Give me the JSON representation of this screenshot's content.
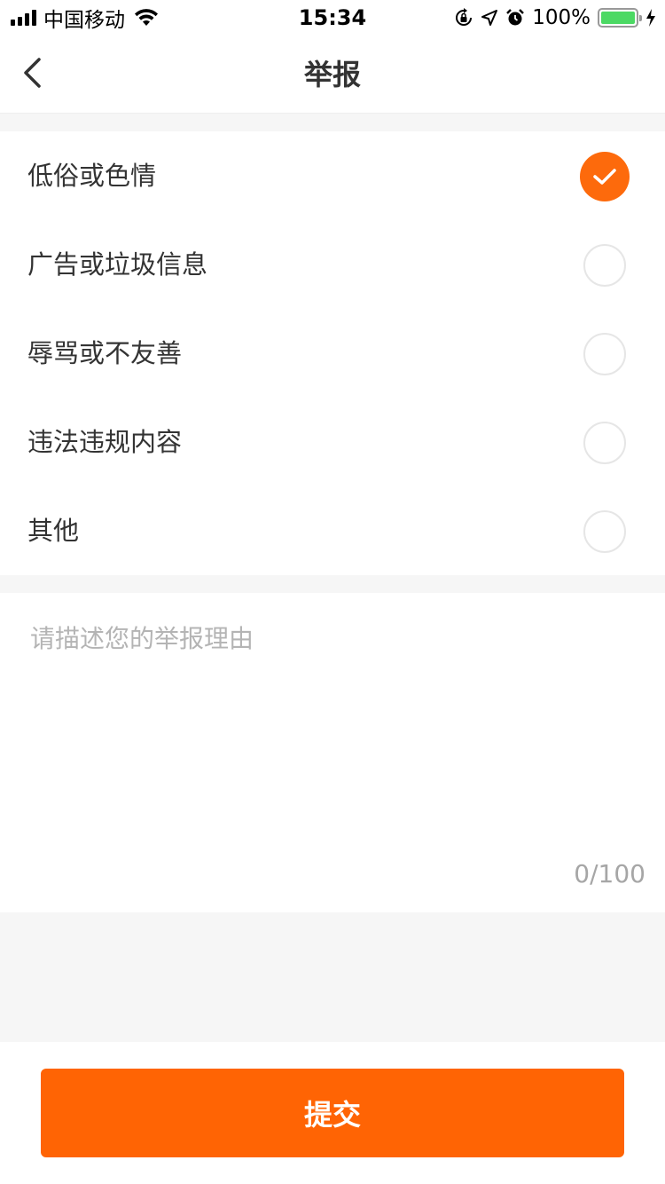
{
  "status_bar": {
    "carrier": "中国移动",
    "time": "15:34",
    "battery_percent": "100%",
    "battery_level": 1.0,
    "icons": [
      "signal-icon",
      "wifi-icon",
      "orientation-lock-icon",
      "location-arrow-icon",
      "alarm-icon",
      "battery-icon",
      "charging-bolt-icon"
    ]
  },
  "nav": {
    "title": "举报",
    "back_icon": "chevron-left-icon"
  },
  "options": [
    {
      "label": "低俗或色情",
      "selected": true
    },
    {
      "label": "广告或垃圾信息",
      "selected": false
    },
    {
      "label": "辱骂或不友善",
      "selected": false
    },
    {
      "label": "违法违规内容",
      "selected": false
    },
    {
      "label": "其他",
      "selected": false
    }
  ],
  "reason": {
    "placeholder": "请描述您的举报理由",
    "value": "",
    "counter": "0/100"
  },
  "submit": {
    "label": "提交"
  },
  "colors": {
    "accent": "#ff6404",
    "check_fill": "#fd6a0c",
    "background": "#f6f6f6"
  }
}
